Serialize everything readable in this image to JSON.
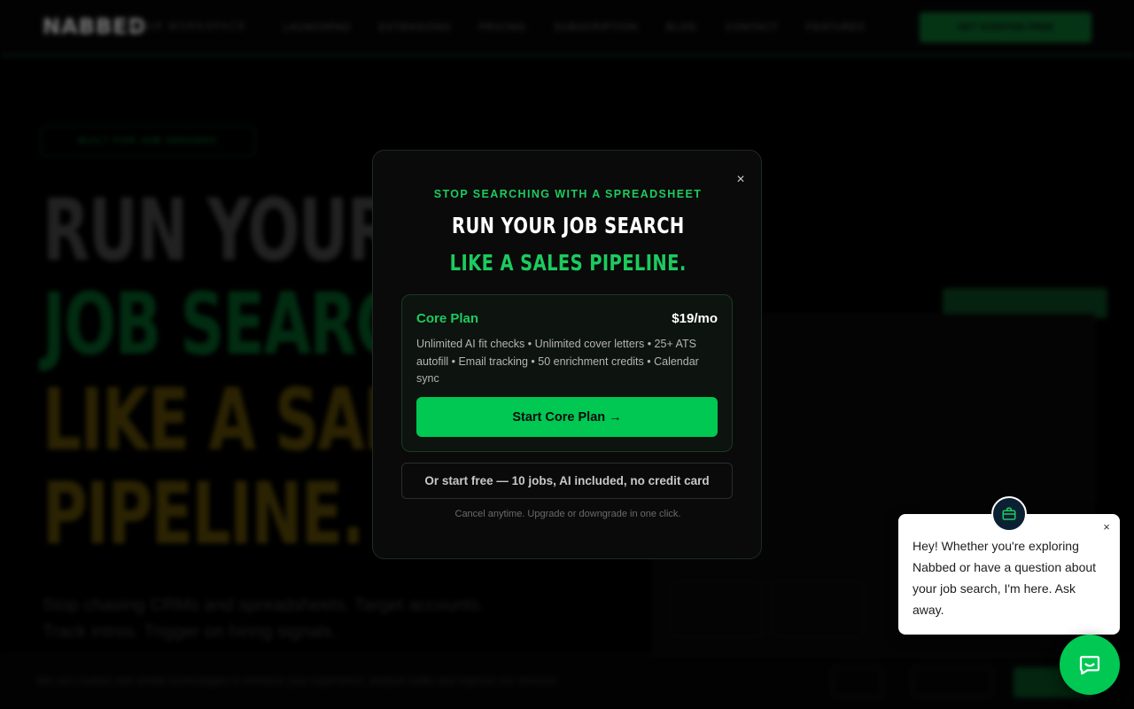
{
  "nav": {
    "logo": "NABBED",
    "logo_sub": "YOUR WORKSPACE",
    "links": [
      "LAUNCHPAD",
      "EXTENSIONS",
      "PRICING",
      "SUBSCRIPTION",
      "BLOG",
      "CONTACT",
      "FEATURES"
    ],
    "cta": "GET STARTED FREE"
  },
  "hero": {
    "badge": "BUILT FOR JOB SEEKERS",
    "line1": "RUN YOUR",
    "line2": "JOB SEARCH",
    "line3": "LIKE A SALES",
    "line4": "PIPELINE.",
    "subtext": "Stop chasing CRMs and spreadsheets. Target accounts. Track intros. Trigger on hiring signals."
  },
  "cookie": {
    "text": "We use cookies and similar technologies to enhance your experience, analyze traffic and improve our services.",
    "buttons": [
      "Manage",
      "Accept all"
    ]
  },
  "modal": {
    "eyebrow": "STOP SEARCHING WITH A SPREADSHEET",
    "title_line1": "RUN YOUR JOB SEARCH",
    "title_line2": "LIKE A SALES PIPELINE.",
    "close_icon": "×",
    "plan": {
      "name": "Core Plan",
      "price": "$19/mo",
      "features": "Unlimited AI fit checks • Unlimited cover letters • 25+ ATS autofill • Email tracking • 50 enrichment credits • Calendar sync",
      "cta": "Start Core Plan →"
    },
    "free_cta": "Or start free — 10 jobs, AI included, no credit card",
    "fine_print": "Cancel anytime. Upgrade or downgrade in one click."
  },
  "chat": {
    "message": "Hey! Whether you're exploring Nabbed or have a question about your job search, I'm here. Ask away.",
    "close_icon": "×",
    "avatar_icon": "briefcase-icon",
    "launcher_icon": "chat-icon"
  },
  "colors": {
    "accent": "#1ccb5e",
    "button": "#00c853",
    "background": "#000000"
  }
}
